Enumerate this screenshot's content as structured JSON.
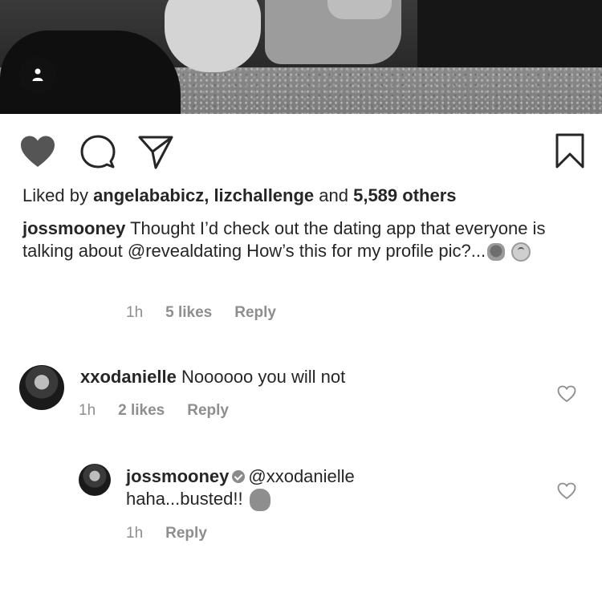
{
  "post": {
    "liked_by_prefix": "Liked by ",
    "liked_by_users": "angelababicz, lizchallenge",
    "liked_by_and": " and ",
    "liked_by_others": "5,589 others",
    "caption_user": "jossmooney",
    "caption_text": "Thought I’d check out the dating app that everyone is talking about @revealdating How’s this for my profile pic?...",
    "caption_time": "1h",
    "caption_likes": "5 likes",
    "caption_reply": "Reply"
  },
  "icons": {
    "heart": "heart-icon",
    "comment": "comment-icon",
    "share": "paper-plane-icon",
    "save": "bookmark-icon",
    "user_tag": "person-tag-icon"
  },
  "comments": [
    {
      "user": "xxodanielle",
      "text": "Noooooo you will not",
      "time": "1h",
      "likes": "2 likes",
      "reply": "Reply"
    },
    {
      "user": "jossmooney",
      "mention": "@xxodanielle",
      "text": "haha...busted!!",
      "time": "1h",
      "reply": "Reply"
    }
  ],
  "colors": {
    "text": "#262626",
    "muted": "#8e8e8e",
    "liked_heart": "#555555"
  }
}
